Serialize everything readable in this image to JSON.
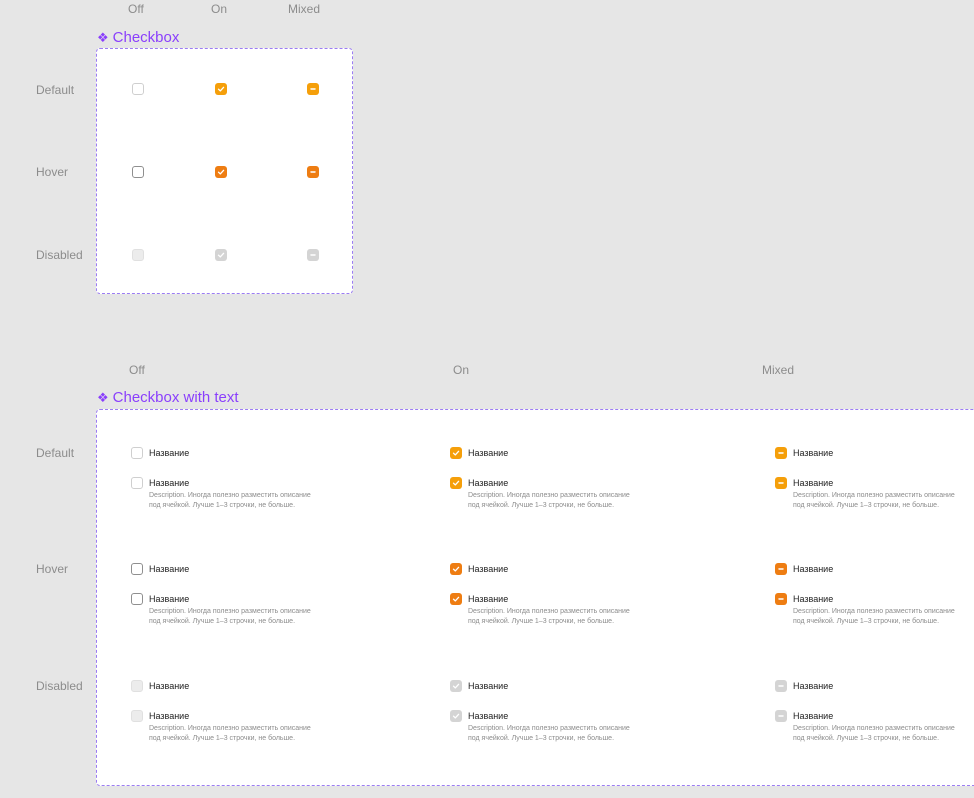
{
  "section1": {
    "title": "Checkbox",
    "columns": [
      "Off",
      "On",
      "Mixed"
    ],
    "rows": [
      "Default",
      "Hover",
      "Disabled"
    ]
  },
  "section2": {
    "title": "Checkbox with text",
    "columns": [
      "Off",
      "On",
      "Mixed"
    ],
    "rows": [
      "Default",
      "Hover",
      "Disabled"
    ],
    "item_label": "Название",
    "description_line1": "Description. Иногда полезно разместить описание",
    "description_line2": "под ячейкой. Лучше 1–3 строчки, не больше."
  },
  "icons": {
    "component": "component-diamond-icon",
    "check": "checkmark-icon",
    "mixed": "minus-icon"
  },
  "colors": {
    "accent": "#f59f0a",
    "accent_hover": "#ee7d12",
    "disabled": "#d4d4d4",
    "component_purple": "#8a3ffc",
    "frame_border": "#9b7cf3"
  }
}
